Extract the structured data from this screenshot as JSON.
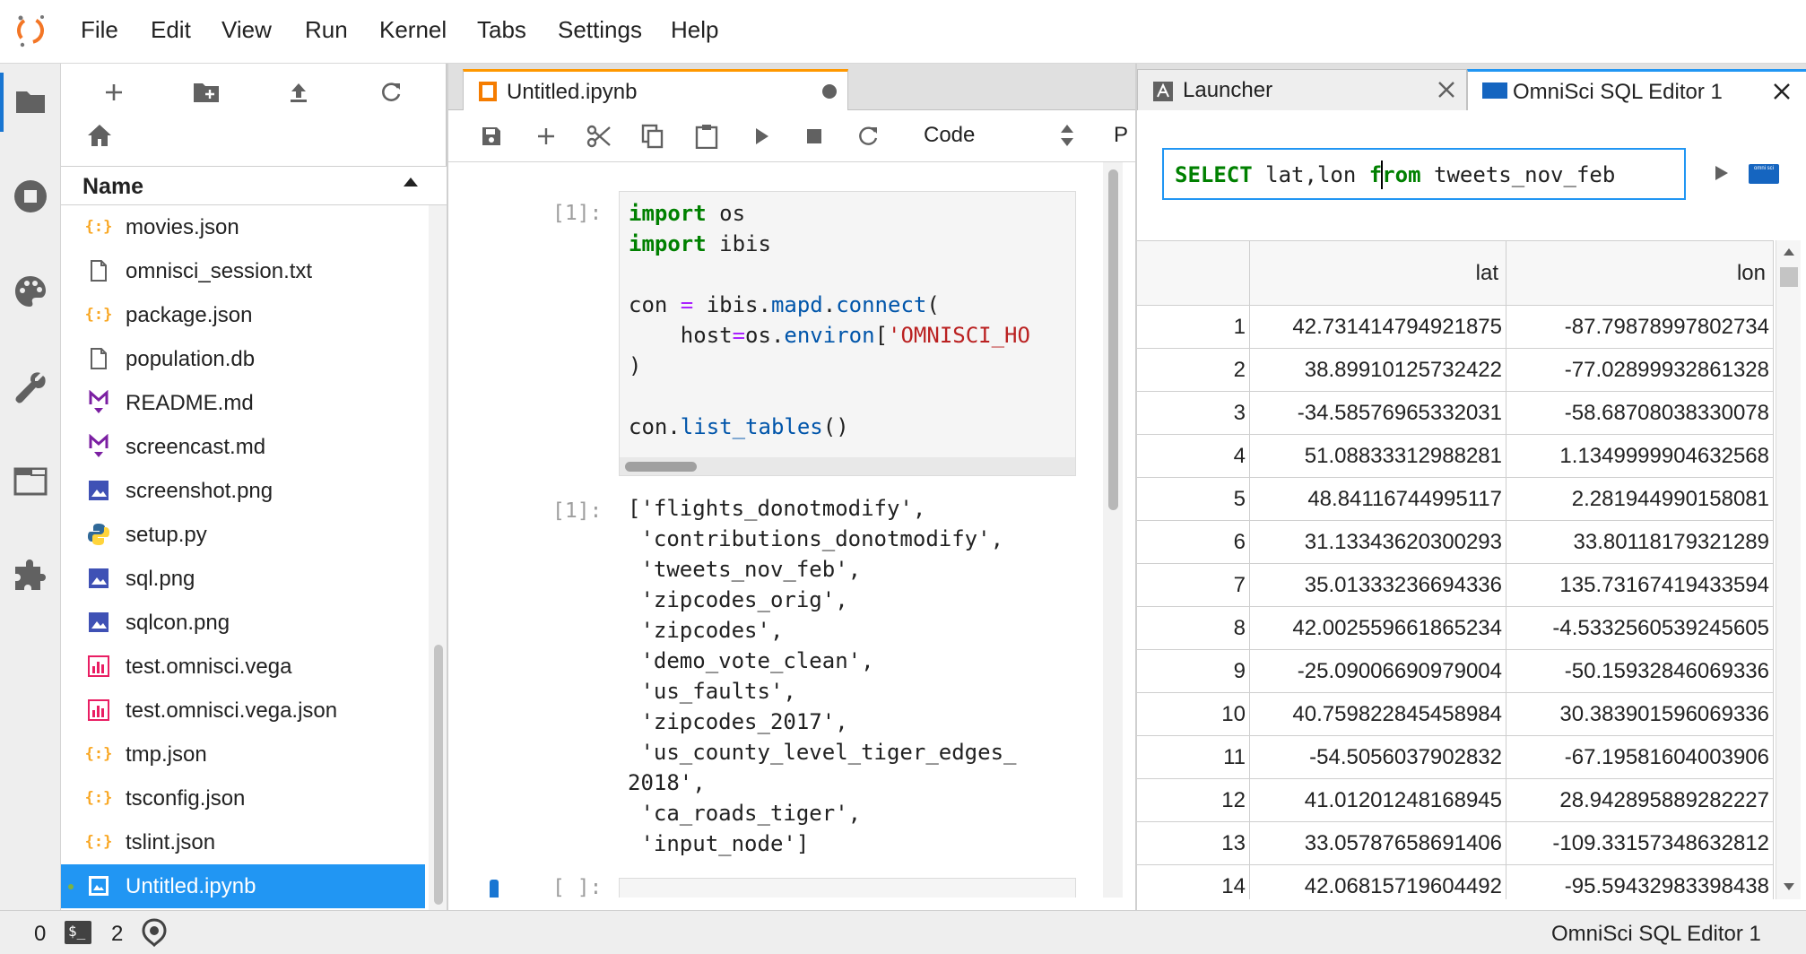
{
  "menubar": {
    "items": [
      "File",
      "Edit",
      "View",
      "Run",
      "Kernel",
      "Tabs",
      "Settings",
      "Help"
    ]
  },
  "sidebar": {
    "icons": [
      "folder-icon",
      "running-icon",
      "palette-icon",
      "wrench-icon",
      "tabs-icon",
      "extension-icon"
    ]
  },
  "filebrowser": {
    "toolbar": [
      "new-launcher-icon",
      "new-folder-icon",
      "upload-icon",
      "refresh-icon"
    ],
    "header_name": "Name",
    "files": [
      {
        "name": "movies.json",
        "type": "json"
      },
      {
        "name": "omnisci_session.txt",
        "type": "file"
      },
      {
        "name": "package.json",
        "type": "json"
      },
      {
        "name": "population.db",
        "type": "file"
      },
      {
        "name": "README.md",
        "type": "markdown"
      },
      {
        "name": "screencast.md",
        "type": "markdown"
      },
      {
        "name": "screenshot.png",
        "type": "image"
      },
      {
        "name": "setup.py",
        "type": "python"
      },
      {
        "name": "sql.png",
        "type": "image"
      },
      {
        "name": "sqlcon.png",
        "type": "image"
      },
      {
        "name": "test.omnisci.vega",
        "type": "vega"
      },
      {
        "name": "test.omnisci.vega.json",
        "type": "vega"
      },
      {
        "name": "tmp.json",
        "type": "json"
      },
      {
        "name": "tsconfig.json",
        "type": "json"
      },
      {
        "name": "tslint.json",
        "type": "json"
      },
      {
        "name": "Untitled.ipynb",
        "type": "notebook",
        "selected": true
      }
    ]
  },
  "notebook": {
    "tab_title": "Untitled.ipynb",
    "cell_type": "Code",
    "toolbar_extra": "P",
    "input_prompt": "[1]:",
    "output_prompt": "[1]:",
    "code": {
      "l1_kw": "import",
      "l1_rest": " os",
      "l2_kw": "import",
      "l2_rest": " ibis",
      "l4_a": "con ",
      "l4_op": "=",
      "l4_b": " ibis.",
      "l4_fn1": "mapd",
      "l4_dot": ".",
      "l4_fn2": "connect",
      "l4_paren": "(",
      "l5_a": "    host",
      "l5_op": "=",
      "l5_b": "os.",
      "l5_fn": "environ",
      "l5_br": "[",
      "l5_str": "'OMNISCI_HO",
      "l6": ")",
      "l8_a": "con.",
      "l8_fn": "list_tables",
      "l8_b": "()"
    },
    "output_lines": [
      "['flights_donotmodify',",
      " 'contributions_donotmodify',",
      " 'tweets_nov_feb',",
      " 'zipcodes_orig',",
      " 'zipcodes',",
      " 'demo_vote_clean',",
      " 'us_faults',",
      " 'zipcodes_2017',",
      " 'us_county_level_tiger_edges_",
      "2018',",
      " 'ca_roads_tiger',",
      " 'input_node']"
    ],
    "stub_prompt": "[ ]:"
  },
  "sql_editor": {
    "tabs": [
      {
        "label": "Launcher"
      },
      {
        "label": "OmniSci SQL Editor 1"
      }
    ],
    "query": {
      "kw1": "SELECT",
      "mid": " lat,lon ",
      "kw2": "from",
      "rest": " tweets_nov_feb"
    },
    "logo_text": "omni sci",
    "columns": [
      "",
      "lat",
      "lon"
    ],
    "rows": [
      [
        "1",
        "42.731414794921875",
        "-87.79878997802734"
      ],
      [
        "2",
        "38.89910125732422",
        "-77.02899932861328"
      ],
      [
        "3",
        "-34.58576965332031",
        "-58.68708038330078"
      ],
      [
        "4",
        "51.08833312988281",
        "1.1349999904632568"
      ],
      [
        "5",
        "48.84116744995117",
        "2.281944990158081"
      ],
      [
        "6",
        "31.13343620300293",
        "33.80118179321289"
      ],
      [
        "7",
        "35.01333236694336",
        "135.73167419433594"
      ],
      [
        "8",
        "42.002559661865234",
        "-4.5332560539245605"
      ],
      [
        "9",
        "-25.09006690979004",
        "-50.15932846069336"
      ],
      [
        "10",
        "40.759822845458984",
        "30.383901596069336"
      ],
      [
        "11",
        "-54.5056037902832",
        "-67.19581604003906"
      ],
      [
        "12",
        "41.01201248168945",
        "28.942895889282227"
      ],
      [
        "13",
        "33.05787658691406",
        "-109.33157348632812"
      ],
      [
        "14",
        "42.06815719604492",
        "-95.59432983398438"
      ]
    ]
  },
  "statusbar": {
    "kernels": "0",
    "terminals": "2",
    "right_label": "OmniSci SQL Editor 1"
  },
  "colors": {
    "accent": "#2196f3",
    "notebook_tab": "#ff9800",
    "json_icon": "#f9a825",
    "markdown_icon": "#7b1fa2",
    "image_icon": "#3f51b5",
    "vega_icon": "#e91e63"
  }
}
